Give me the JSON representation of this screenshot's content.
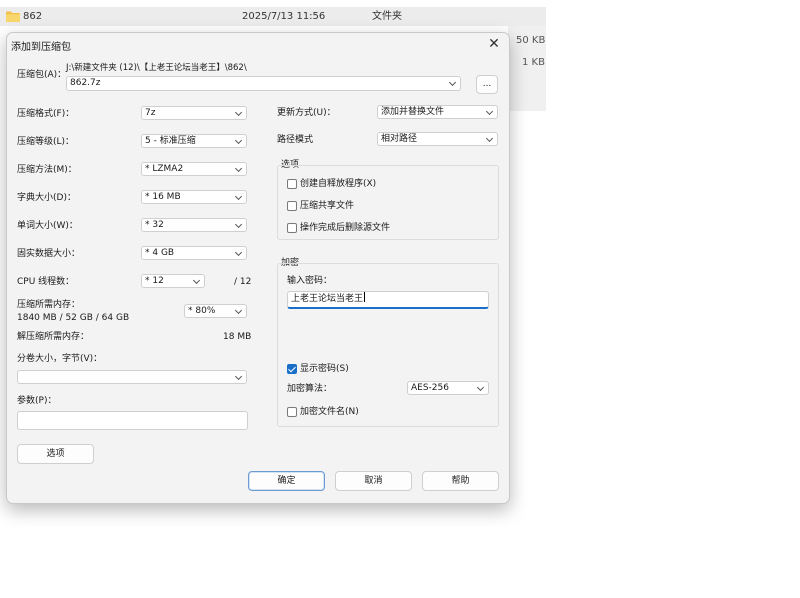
{
  "background": {
    "folder_name": "862",
    "folder_date": "2025/7/13 11:56",
    "folder_type": "文件夹",
    "sizes": [
      "50 KB",
      "1 KB"
    ]
  },
  "dialog": {
    "title": "添加到压缩包",
    "close_glyph": "✕",
    "archive_label": "压缩包(A)：",
    "archive_path": "J:\\新建文件夹 (12)\\【上老王论坛当老王】\\862\\",
    "archive_name": "862.7z",
    "browse_label": "...",
    "left": {
      "format_label": "压缩格式(F)：",
      "format_value": "7z",
      "level_label": "压缩等级(L)：",
      "level_value": "5 - 标准压缩",
      "method_label": "压缩方法(M)：",
      "method_value": "* LZMA2",
      "dict_label": "字典大小(D)：",
      "dict_value": "* 16 MB",
      "word_label": "单词大小(W)：",
      "word_value": "* 32",
      "solid_label": "固实数据大小：",
      "solid_value": "* 4 GB",
      "threads_label": "CPU 线程数：",
      "threads_value": "* 12",
      "threads_max": "/ 12",
      "mem_label": "压缩所需内存：",
      "mem_detail": "1840 MB / 52 GB / 64 GB",
      "mem_value": "* 80%",
      "decomp_label": "解压缩所需内存：",
      "decomp_value": "18 MB",
      "split_label": "分卷大小，字节(V)：",
      "split_value": "",
      "params_label": "参数(P)：",
      "params_value": "",
      "options_button": "选项"
    },
    "right": {
      "update_label": "更新方式(U)：",
      "update_value": "添加并替换文件",
      "pathmode_label": "路径模式",
      "pathmode_value": "相对路径",
      "options_group": "选项",
      "opt_sfx": "创建自释放程序(X)",
      "opt_shared": "压缩共享文件",
      "opt_delete": "操作完成后删除源文件",
      "encrypt_group": "加密",
      "password_label": "输入密码：",
      "password_value": "上老王论坛当老王",
      "show_password": "显示密码(S)",
      "show_password_checked": true,
      "enc_method_label": "加密算法：",
      "enc_method_value": "AES-256",
      "enc_names": "加密文件名(N)"
    },
    "buttons": {
      "ok": "确定",
      "cancel": "取消",
      "help": "帮助"
    }
  }
}
